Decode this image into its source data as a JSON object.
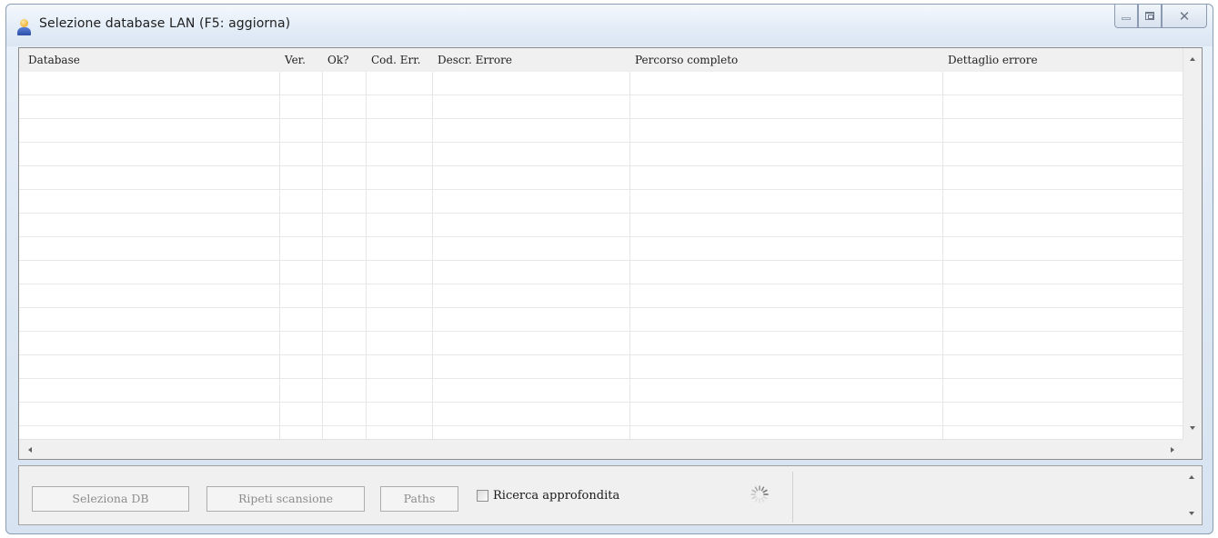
{
  "window": {
    "title": "Selezione database LAN (F5: aggiorna)"
  },
  "table": {
    "columns": [
      "Database",
      "Ver.",
      "Ok?",
      "Cod. Err.",
      "Descr. Errore",
      "Percorso completo",
      "Dettaglio errore"
    ],
    "rows": []
  },
  "actions": {
    "select_db": "Seleziona DB",
    "rescan": "Ripeti scansione",
    "paths": "Paths",
    "deep_search_label": "Ricerca approfondita",
    "deep_search_checked": false
  },
  "icons": {
    "app": "user-database-icon",
    "loading": "loading-spinner-icon"
  }
}
